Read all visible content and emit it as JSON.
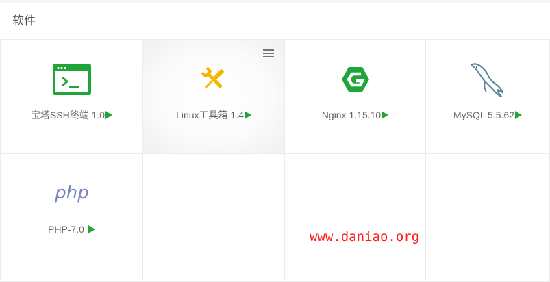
{
  "section": {
    "title": "软件"
  },
  "apps": [
    {
      "name": "宝塔SSH终端 1.0",
      "icon": "terminal-icon",
      "color": "#20a53a"
    },
    {
      "name": "Linux工具箱 1.4",
      "icon": "tools-icon",
      "color": "#f7b500"
    },
    {
      "name": "Nginx 1.15.10",
      "icon": "nginx-icon",
      "color": "#20a53a"
    },
    {
      "name": "MySQL 5.5.62",
      "icon": "mysql-icon",
      "color": "#5d8a9a"
    },
    {
      "name": "PHP-7.0",
      "icon": "php-icon",
      "color": "#7a86b8"
    }
  ],
  "toolbar": {
    "menu_icon": "hamburger-menu-icon"
  },
  "watermark": {
    "text": "www.daniao.org"
  },
  "colors": {
    "accent": "#20a53a",
    "watermark": "#ff1a1a"
  }
}
